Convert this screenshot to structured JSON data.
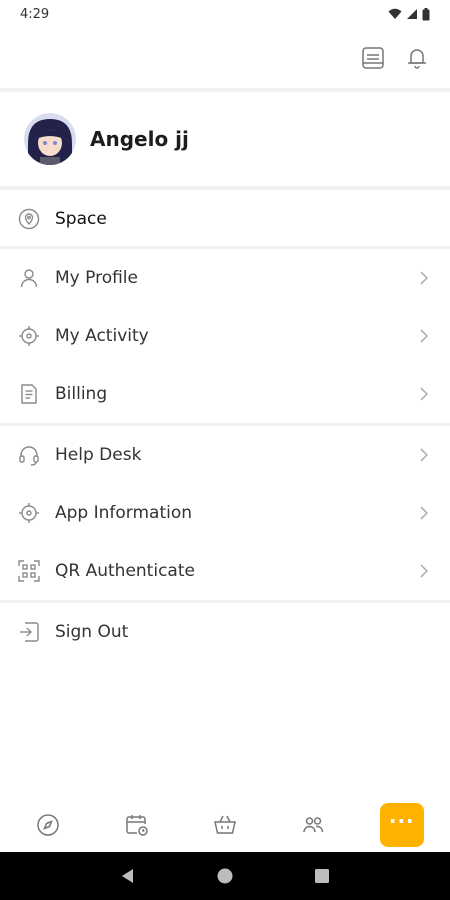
{
  "status_bar": {
    "time": "4:29"
  },
  "profile": {
    "name": "Angelo jj"
  },
  "menu": {
    "space": "Space",
    "my_profile": "My Profile",
    "my_activity": "My Activity",
    "billing": "Billing",
    "help_desk": "Help Desk",
    "app_information": "App Information",
    "qr_authenticate": "QR Authenticate",
    "sign_out": "Sign Out"
  },
  "bottom_nav": {
    "items": [
      "compass-icon",
      "calendar-clock-icon",
      "basket-icon",
      "people-icon",
      "more-icon"
    ],
    "active": "more",
    "more_label": "···"
  },
  "colors": {
    "accent": "#FFB300",
    "icon": "#8a8a8a",
    "divider": "#f1f1f1"
  }
}
